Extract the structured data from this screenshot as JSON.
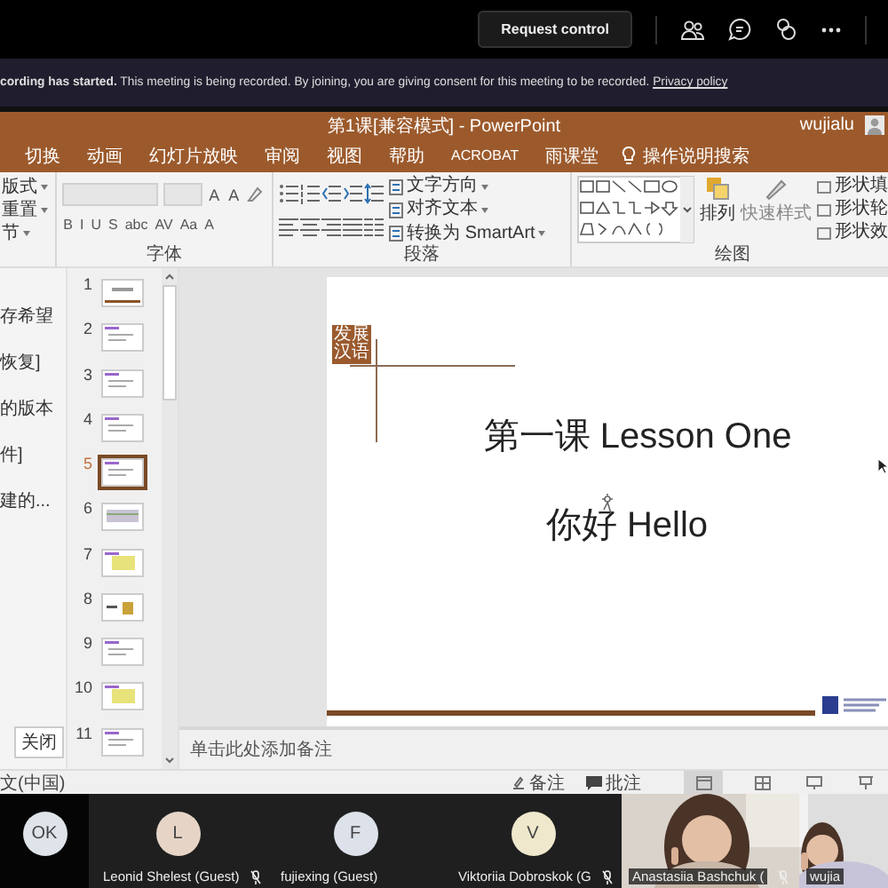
{
  "top_bar": {
    "request_button": "Request control"
  },
  "banner": {
    "text": "**cording has started.** This meeting is being recorded. By joining, you are giving consent for this meeting to be recorded.",
    "link": "Privacy policy"
  },
  "powerpoint": {
    "title": "第1课[兼容模式] - PowerPoint",
    "user": "wujialu",
    "tabs": [
      {
        "label": "切换",
        "selected": false
      },
      {
        "label": "动画",
        "selected": false
      },
      {
        "label": "幻灯片放映",
        "selected": false
      },
      {
        "label": "审阅",
        "selected": false
      },
      {
        "label": "视图",
        "selected": false
      },
      {
        "label": "帮助",
        "selected": false
      },
      {
        "label": "ACROBAT",
        "selected": false
      },
      {
        "label": "雨课堂",
        "selected": false
      }
    ],
    "search": "操作说明搜索",
    "ribbon": {
      "slides_commands": [
        "版式",
        "重置",
        "节"
      ],
      "font": {
        "label": "字体",
        "size_buttons": [
          "A",
          "A"
        ],
        "format_buttons": [
          "B",
          "I",
          "U",
          "S",
          "abc",
          "AV",
          "Aa",
          "A"
        ]
      },
      "paragraph": {
        "label": "段落",
        "commands": [
          "文字方向",
          "对齐文本",
          "转换为 SmartArt"
        ]
      },
      "drawing": {
        "label": "绘图",
        "arrange": "排列",
        "quick_styles": "快速样式",
        "shape_commands": [
          "形状填",
          "形状轮",
          "形状效"
        ]
      }
    },
    "recovery_pane": {
      "items": [
        "存希望",
        "恢复]",
        "的版本",
        "件]",
        "建的..."
      ],
      "close": "关闭"
    },
    "slides": [
      {
        "number": "1",
        "selected": false
      },
      {
        "number": "2",
        "selected": false
      },
      {
        "number": "3",
        "selected": false
      },
      {
        "number": "4",
        "selected": false
      },
      {
        "number": "5",
        "selected": true
      },
      {
        "number": "6",
        "selected": false
      },
      {
        "number": "7",
        "selected": false
      },
      {
        "number": "8",
        "selected": false
      },
      {
        "number": "9",
        "selected": false
      },
      {
        "number": "10",
        "selected": false
      },
      {
        "number": "11",
        "selected": false
      }
    ],
    "slide": {
      "logo": "发展汉语",
      "title": "第一课 Lesson One",
      "subtitle": "你好 Hello"
    },
    "notes": {
      "placeholder": "单击此处添加备注"
    },
    "status_bar": {
      "language": "文(中国)",
      "notes": "备注",
      "comments": "批注"
    }
  },
  "participants": [
    {
      "kind": "avatar",
      "initials": "OK",
      "color": "#dfe4ea"
    },
    {
      "kind": "avatar",
      "initials": "L",
      "color": "#e6d5c7",
      "name": "Leonid Shelest (Guest)",
      "muted": true
    },
    {
      "kind": "avatar",
      "initials": "F",
      "color": "#dde2ea",
      "name": "fujiexing (Guest)",
      "muted": false
    },
    {
      "kind": "avatar",
      "initials": "V",
      "color": "#efe8cc",
      "name": "Viktoriia Dobroskok (G",
      "muted": true
    },
    {
      "kind": "video",
      "name": "Anastasiia Bashchuk (",
      "muted": true
    },
    {
      "kind": "video",
      "name": "wujia",
      "muted": false
    }
  ]
}
